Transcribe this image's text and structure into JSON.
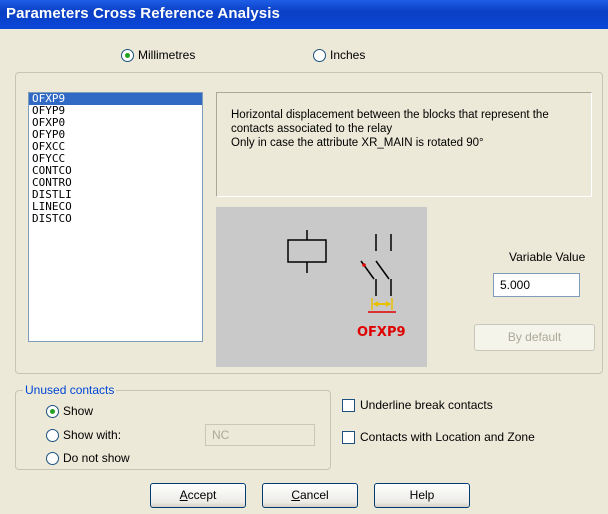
{
  "window": {
    "title": "Parameters Cross Reference Analysis"
  },
  "units": {
    "millimetres_label": "Millimetres",
    "inches_label": "Inches",
    "selected": "Millimetres"
  },
  "parameters": {
    "items": [
      "OFXP9",
      "OFYP9",
      "OFXP0",
      "OFYP0",
      "OFXCC",
      "OFYCC",
      "CONTCO",
      "CONTRO",
      "DISTLI",
      "LINECO",
      "DISTCO"
    ],
    "selected": "OFXP9"
  },
  "description": {
    "lines": [
      "Horizontal displacement between the blocks that represent the",
      "contacts associated to the relay",
      "Only in case the attribute XR_MAIN is rotated 90°"
    ]
  },
  "preview": {
    "label": "OFXP9",
    "label_color": "#e00000",
    "arrow_color": "#e8c000"
  },
  "variable": {
    "label": "Variable Value",
    "value": "5.000",
    "default_button": "By default"
  },
  "unused_contacts": {
    "legend": "Unused contacts",
    "options": [
      "Show",
      "Show with:",
      "Do not show"
    ],
    "selected": "Show",
    "show_with_value": "NC"
  },
  "options": {
    "underline_break": "Underline break contacts",
    "location_zone": "Contacts with Location and Zone"
  },
  "buttons": {
    "accept_prefix": "",
    "accept_mnemonic": "A",
    "accept_rest": "ccept",
    "cancel_mnemonic": "C",
    "cancel_rest": "ancel",
    "help": "Help"
  }
}
